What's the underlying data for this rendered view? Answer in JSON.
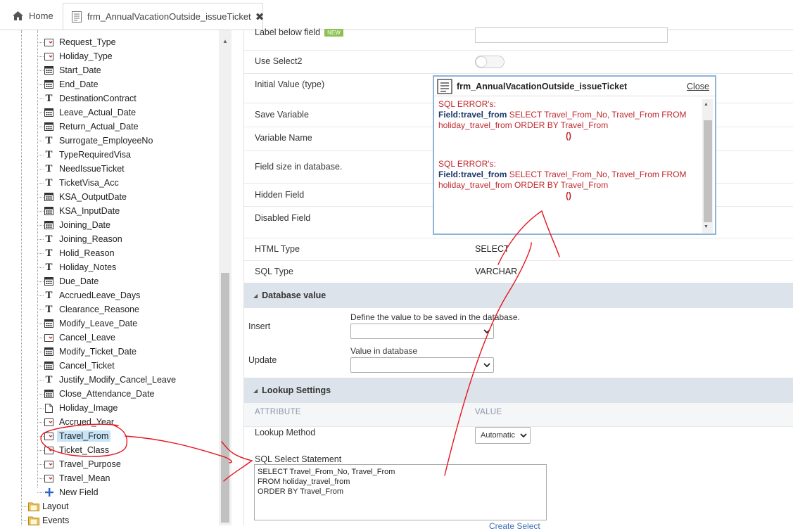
{
  "tabs": {
    "home_label": "Home",
    "active_label": "frm_AnnualVacationOutside_issueTicket",
    "close_glyph": "✖"
  },
  "tree": {
    "items": [
      {
        "label": "Request_Type",
        "icon": "select-field-icon"
      },
      {
        "label": "Holiday_Type",
        "icon": "select-field-icon"
      },
      {
        "label": "Start_Date",
        "icon": "calendar-icon"
      },
      {
        "label": "End_Date",
        "icon": "calendar-icon"
      },
      {
        "label": "DestinationContract",
        "icon": "text-field-icon"
      },
      {
        "label": "Leave_Actual_Date",
        "icon": "calendar-icon"
      },
      {
        "label": "Return_Actual_Date",
        "icon": "calendar-icon"
      },
      {
        "label": "Surrogate_EmployeeNo",
        "icon": "text-field-icon"
      },
      {
        "label": "TypeRequiredVisa",
        "icon": "text-field-icon"
      },
      {
        "label": "NeedIssueTicket",
        "icon": "text-field-icon"
      },
      {
        "label": "TicketVisa_Acc",
        "icon": "text-field-icon"
      },
      {
        "label": "KSA_OutputDate",
        "icon": "calendar-icon"
      },
      {
        "label": "KSA_InputDate",
        "icon": "calendar-icon"
      },
      {
        "label": "Joining_Date",
        "icon": "calendar-icon"
      },
      {
        "label": "Joining_Reason",
        "icon": "text-field-icon"
      },
      {
        "label": "Holid_Reason",
        "icon": "text-field-icon"
      },
      {
        "label": "Holiday_Notes",
        "icon": "text-field-icon"
      },
      {
        "label": "Due_Date",
        "icon": "calendar-icon"
      },
      {
        "label": "AccruedLeave_Days",
        "icon": "text-field-icon"
      },
      {
        "label": "Clearance_Reasone",
        "icon": "text-field-icon"
      },
      {
        "label": "Modify_Leave_Date",
        "icon": "calendar-icon"
      },
      {
        "label": "Cancel_Leave",
        "icon": "select-field-icon"
      },
      {
        "label": "Modify_Ticket_Date",
        "icon": "calendar-icon"
      },
      {
        "label": "Cancel_Ticket",
        "icon": "calendar-icon"
      },
      {
        "label": "Justify_Modify_Cancel_Leave",
        "icon": "text-field-icon"
      },
      {
        "label": "Close_Attendance_Date",
        "icon": "calendar-icon"
      },
      {
        "label": "Holiday_Image",
        "icon": "file-icon"
      },
      {
        "label": "Accrued_Year",
        "icon": "select-field-icon"
      },
      {
        "label": "Travel_From",
        "icon": "select-field-icon",
        "selected": true
      },
      {
        "label": "Ticket_Class",
        "icon": "select-field-icon"
      },
      {
        "label": "Travel_Purpose",
        "icon": "select-field-icon"
      },
      {
        "label": "Travel_Mean",
        "icon": "select-field-icon"
      },
      {
        "label": "New Field",
        "icon": "plus-icon"
      }
    ],
    "folders": [
      {
        "label": "Layout",
        "icon": "folder-icon"
      },
      {
        "label": "Events",
        "icon": "folder-icon"
      }
    ]
  },
  "properties": {
    "label_below_field": "Label below field",
    "new_badge": "NEW",
    "use_select2": "Use Select2",
    "initial_value": "Initial Value (type)",
    "save_variable": "Save Variable",
    "variable_name": "Variable Name",
    "field_size": "Field size in database.",
    "hidden_field": "Hidden Field",
    "disabled_field": "Disabled Field",
    "html_type": "HTML Type",
    "html_type_value": "SELECT",
    "sql_type": "SQL Type",
    "sql_type_value": "VARCHAR"
  },
  "database_value": {
    "title": "Database value",
    "insert_label": "Insert",
    "insert_hint": "Define the value to be saved in the database.",
    "insert_value": "",
    "update_label": "Update",
    "update_hint": "Value in database",
    "update_value": ""
  },
  "lookup": {
    "title": "Lookup Settings",
    "attribute_header": "ATTRIBUTE",
    "value_header": "VALUE",
    "method_label": "Lookup Method",
    "method_value": "Automatic",
    "sql_label": "SQL Select Statement",
    "sql_value": "SELECT Travel_From_No, Travel_From\nFROM holiday_travel_from\nORDER BY Travel_From",
    "create_select": "Create Select"
  },
  "popup": {
    "title": "frm_AnnualVacationOutside_issueTicket",
    "close_label": "Close",
    "errors": [
      {
        "heading": "SQL ERROR's:",
        "field": "Field:travel_from",
        "query": " SELECT Travel_From_No, Travel_From FROM holiday_travel_from ORDER BY Travel_From",
        "paren": "()"
      },
      {
        "heading": "SQL ERROR's:",
        "field": "Field:travel_from",
        "query": " SELECT Travel_From_No, Travel_From FROM holiday_travel_from ORDER BY Travel_From",
        "paren": "()"
      }
    ]
  },
  "colors": {
    "error_red": "#c0282d",
    "field_blue": "#1e3a6b",
    "annotation_red": "#e8141e",
    "section_bg": "#dde3ea",
    "popup_border": "#8eb4d8"
  }
}
